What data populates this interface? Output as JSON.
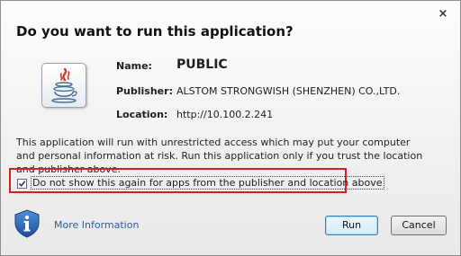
{
  "dialog": {
    "title": "Do you want to run this application?",
    "close_label": "×"
  },
  "app_info": {
    "name_label": "Name:",
    "name_value": "PUBLIC",
    "publisher_label": "Publisher:",
    "publisher_value": "ALSTOM STRONGWISH (SHENZHEN) CO.,LTD.",
    "location_label": "Location:",
    "location_value": "http://10.100.2.241"
  },
  "warning_text": "This application will run with unrestricted access which may put your computer and personal information at risk. Run this application only if you trust the location and publisher above.",
  "checkbox": {
    "label": "Do not show this again for apps from the publisher and location above",
    "checked": true
  },
  "footer": {
    "more_info_label": "More Information",
    "run_label": "Run",
    "cancel_label": "Cancel"
  },
  "colors": {
    "highlight_border": "#d21f24",
    "link": "#2b5d9a",
    "default_button_border": "#3c7fb1"
  },
  "icons": {
    "app_icon": "java-icon",
    "info_icon": "info-shield-icon",
    "close_icon": "close-icon",
    "check_icon": "checkmark-icon"
  }
}
